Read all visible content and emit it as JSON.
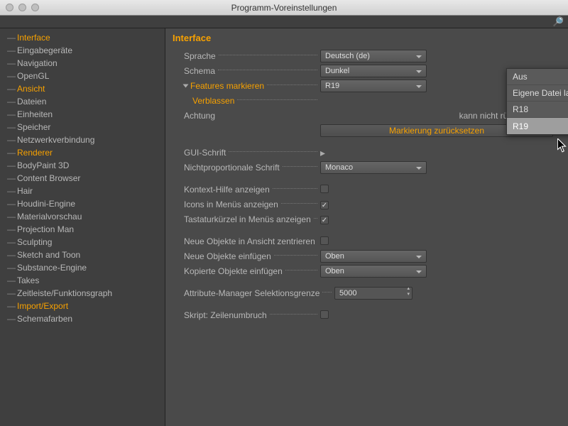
{
  "window": {
    "title": "Programm-Voreinstellungen"
  },
  "sidebar": {
    "items": [
      {
        "label": "Interface",
        "active": true
      },
      {
        "label": "Eingabegeräte"
      },
      {
        "label": "Navigation"
      },
      {
        "label": "OpenGL"
      },
      {
        "label": "Ansicht",
        "active": true
      },
      {
        "label": "Dateien"
      },
      {
        "label": "Einheiten"
      },
      {
        "label": "Speicher"
      },
      {
        "label": "Netzwerkverbindung"
      },
      {
        "label": "Renderer",
        "active": true
      },
      {
        "label": "BodyPaint 3D"
      },
      {
        "label": "Content Browser"
      },
      {
        "label": "Hair"
      },
      {
        "label": "Houdini-Engine"
      },
      {
        "label": "Materialvorschau"
      },
      {
        "label": "Projection Man"
      },
      {
        "label": "Sculpting"
      },
      {
        "label": "Sketch and Toon"
      },
      {
        "label": "Substance-Engine"
      },
      {
        "label": "Takes"
      },
      {
        "label": "Zeitleiste/Funktionsgraph"
      },
      {
        "label": "Import/Export",
        "active": true
      },
      {
        "label": "Schemafarben"
      }
    ]
  },
  "panel": {
    "title": "Interface",
    "sprache": {
      "label": "Sprache",
      "value": "Deutsch (de)"
    },
    "schema": {
      "label": "Schema",
      "value": "Dunkel"
    },
    "features": {
      "label": "Features markieren",
      "value": "R19"
    },
    "verblassen": {
      "label": "Verblassen"
    },
    "achtung": {
      "label": "Achtung",
      "text": "kann nicht rückgängig gem"
    },
    "reset_btn": "Markierung zurücksetzen",
    "gui_schrift": {
      "label": "GUI-Schrift"
    },
    "mono_schrift": {
      "label": "Nichtproportionale Schrift",
      "value": "Monaco"
    },
    "kontext_hilfe": {
      "label": "Kontext-Hilfe anzeigen",
      "checked": false
    },
    "icons_menus": {
      "label": "Icons in Menüs anzeigen",
      "checked": true
    },
    "tastatur": {
      "label": "Tastaturkürzel in Menüs anzeigen",
      "checked": true
    },
    "neue_zentrieren": {
      "label": "Neue Objekte in Ansicht zentrieren",
      "checked": false
    },
    "neue_einfuegen": {
      "label": "Neue Objekte einfügen",
      "value": "Oben"
    },
    "kopierte_einfuegen": {
      "label": "Kopierte Objekte einfügen",
      "value": "Oben"
    },
    "attr_manager": {
      "label": "Attribute-Manager Selektionsgrenze",
      "value": "5000"
    },
    "skript": {
      "label": "Skript: Zeilenumbruch",
      "checked": false
    }
  },
  "dropdown": {
    "items": [
      {
        "label": "Aus"
      },
      {
        "label": "Eigene Datei laden..."
      },
      {
        "label": "R18"
      },
      {
        "label": "R19",
        "highlight": true
      }
    ]
  }
}
